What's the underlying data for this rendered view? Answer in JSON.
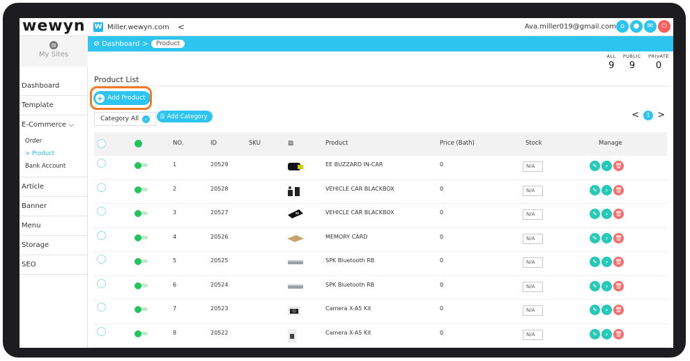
{
  "app": {
    "logo": "wewyn",
    "site_name": "Miller.wewyn.com",
    "user_email": "Ava.miller019@gmail.com"
  },
  "sidebar": {
    "my_sites": "My Sites",
    "items": [
      {
        "label": "Dashboard"
      },
      {
        "label": "Template"
      },
      {
        "label": "E-Commerce ⌵"
      },
      {
        "label": "Article"
      },
      {
        "label": "Banner"
      },
      {
        "label": "Menu"
      },
      {
        "label": "Storage"
      },
      {
        "label": "SEO"
      }
    ],
    "ecommerce_sub": [
      {
        "label": "Order"
      },
      {
        "label": "> Product"
      },
      {
        "label": "Bank Account"
      }
    ]
  },
  "breadcrumb": {
    "home": "Dashboard",
    "sep": ">",
    "current": "Product"
  },
  "counts": [
    {
      "label": "ALL",
      "value": "9"
    },
    {
      "label": "PUBLIC",
      "value": "9"
    },
    {
      "label": "PRIVATE",
      "value": "0"
    }
  ],
  "page": {
    "title": "Product List",
    "add_product": "Add Product",
    "category_label": "Category All",
    "add_category": "Add Category",
    "page_prev": "<",
    "page_current": "1",
    "page_next": ">"
  },
  "table": {
    "headers": {
      "no": "NO.",
      "id": "ID",
      "sku": "SKU",
      "product": "Product",
      "price": "Price (Bath)",
      "stock": "Stock",
      "manage": "Manage"
    },
    "rows": [
      {
        "no": "1",
        "id": "20529",
        "sku": "",
        "product": "EE BUZZARD IN-CAR",
        "price": "0",
        "stock": "N/A",
        "thumb": "car-camera"
      },
      {
        "no": "2",
        "id": "20528",
        "sku": "",
        "product": "VEHICLE CAR BLACKBOX",
        "price": "0",
        "stock": "N/A",
        "thumb": "blackbox"
      },
      {
        "no": "3",
        "id": "20527",
        "sku": "",
        "product": "VEHICLE CAR BLACKBOX",
        "price": "0",
        "stock": "N/A",
        "thumb": "memory-card"
      },
      {
        "no": "4",
        "id": "20526",
        "sku": "",
        "product": "MEMORY CARD",
        "price": "0",
        "stock": "N/A",
        "thumb": "gold-card"
      },
      {
        "no": "5",
        "id": "20525",
        "sku": "",
        "product": "SPK Bluetooth RB",
        "price": "0",
        "stock": "N/A",
        "thumb": "speaker"
      },
      {
        "no": "6",
        "id": "20524",
        "sku": "",
        "product": "SPK Bluetooth RB",
        "price": "0",
        "stock": "N/A",
        "thumb": "speaker"
      },
      {
        "no": "7",
        "id": "20523",
        "sku": "",
        "product": "Camera X-A5 Kit",
        "price": "0",
        "stock": "N/A",
        "thumb": "camera"
      },
      {
        "no": "8",
        "id": "20522",
        "sku": "",
        "product": "Camera X-A5 Kit",
        "price": "0",
        "stock": "N/A",
        "thumb": "camera-box"
      }
    ]
  },
  "colors": {
    "accent": "#2ec4f0",
    "highlight": "#f07a2a",
    "active_green": "#22c55e",
    "delete_red": "#ff6b6b"
  }
}
